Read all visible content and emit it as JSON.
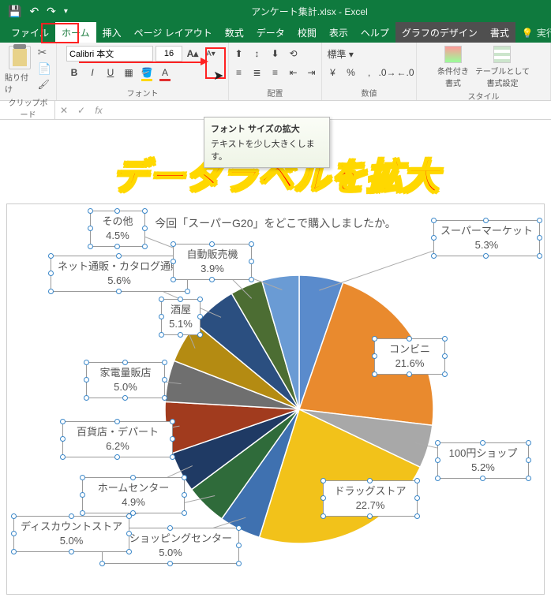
{
  "titlebar": {
    "title": "アンケート集計.xlsx - Excel"
  },
  "tabs": {
    "file": "ファイル",
    "home": "ホーム",
    "insert": "挿入",
    "layout": "ページ レイアウト",
    "formulas": "数式",
    "data": "データ",
    "review": "校閲",
    "view": "表示",
    "help": "ヘルプ",
    "design": "グラフのデザイン",
    "format": "書式",
    "tell": "実行したい作業を"
  },
  "ribbon": {
    "clipboard_label": "クリップボード",
    "paste_label": "貼り付け",
    "font_label": "フォント",
    "font_name": "Calibri 本文",
    "font_size": "16",
    "align_label": "配置",
    "number_label": "数値",
    "style_label": "スタイル",
    "cond_format": "条件付き\n書式",
    "table_format": "テーブルとして\n書式設定"
  },
  "tooltip": {
    "title": "フォント サイズの拡大",
    "body": "テキストを少し大きくします。"
  },
  "overlay_text": "データラベルを拡大",
  "chart_data": {
    "type": "pie",
    "title": "今回「スーパーG20」をどこで購入しましたか。",
    "series": [
      {
        "name": "スーパーマーケット",
        "value": 5.3,
        "color": "#5a8bcc"
      },
      {
        "name": "コンビニ",
        "value": 21.6,
        "color": "#e98a2e"
      },
      {
        "name": "100円ショップ",
        "value": 5.2,
        "color": "#a8a8a8"
      },
      {
        "name": "ドラッグストア",
        "value": 22.7,
        "color": "#f2c21a"
      },
      {
        "name": "大型ショッピングセンター",
        "value": 5.0,
        "color": "#3f71b0"
      },
      {
        "name": "ディスカウントストア",
        "value": 5.0,
        "color": "#2f6b3a"
      },
      {
        "name": "ホームセンター",
        "value": 4.9,
        "color": "#1f3a64"
      },
      {
        "name": "百貨店・デパート",
        "value": 6.2,
        "color": "#a13b1e"
      },
      {
        "name": "家電量販店",
        "value": 5.0,
        "color": "#6f6f6f"
      },
      {
        "name": "酒屋",
        "value": 5.1,
        "color": "#b48b12"
      },
      {
        "name": "ネット通販・カタログ通販",
        "value": 5.6,
        "color": "#2b4f80"
      },
      {
        "name": "自動販売機",
        "value": 3.9,
        "color": "#4c6d33"
      },
      {
        "name": "その他",
        "value": 4.5,
        "color": "#6a9bd4"
      }
    ]
  }
}
